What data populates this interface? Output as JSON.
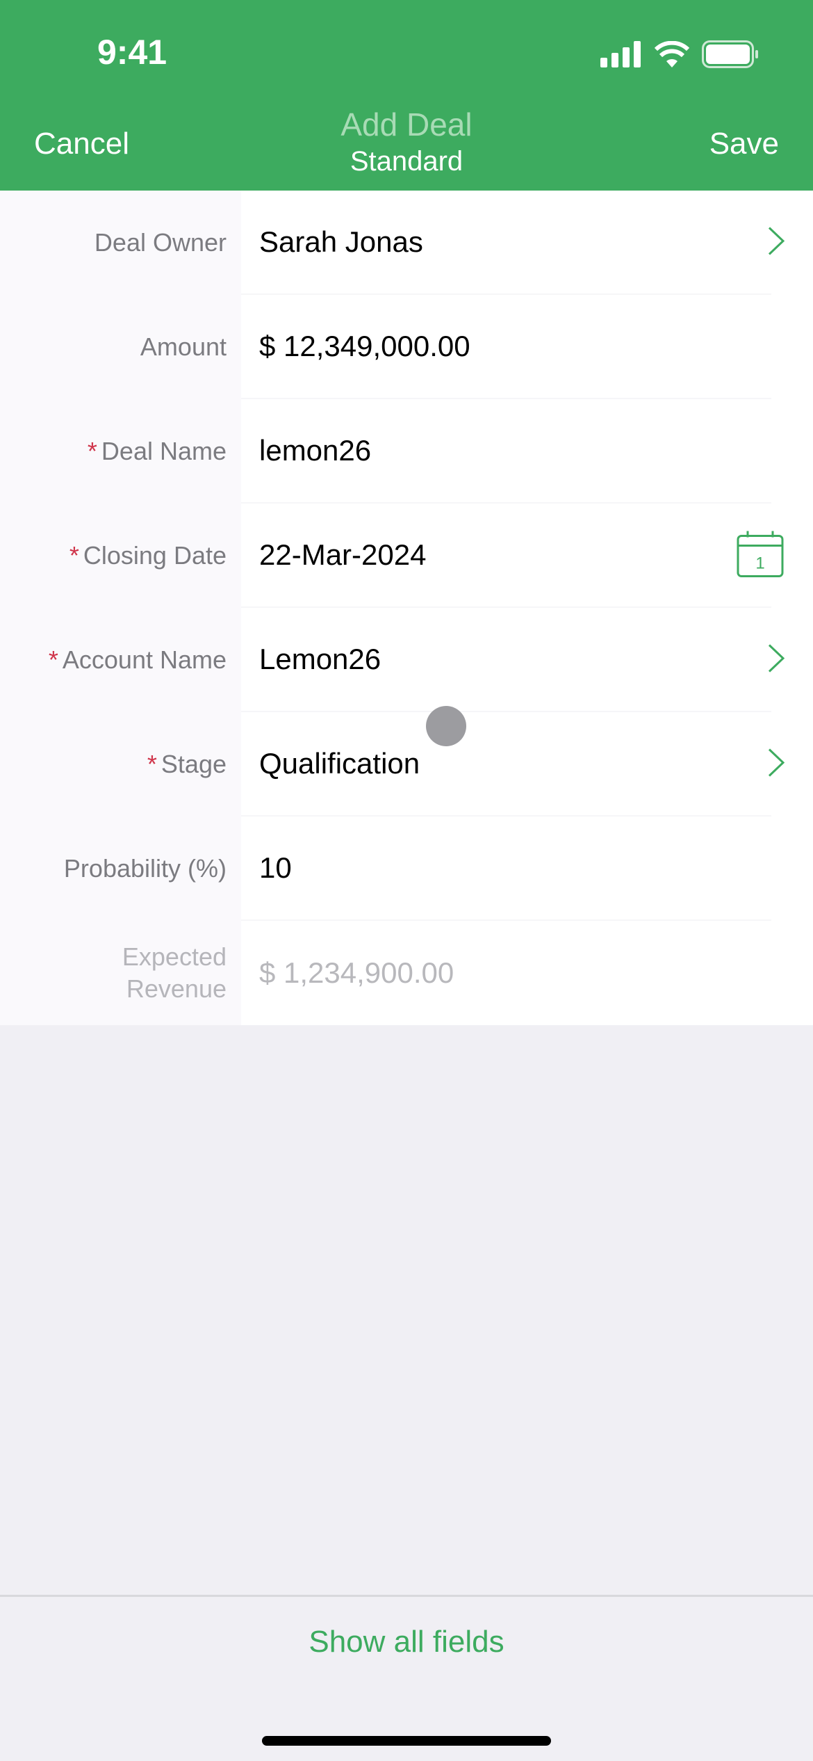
{
  "status_bar": {
    "time": "9:41",
    "icons": [
      "signal-icon",
      "wifi-icon",
      "battery-icon"
    ]
  },
  "nav": {
    "cancel": "Cancel",
    "title": "Add Deal",
    "subtitle": "Standard",
    "save": "Save"
  },
  "colors": {
    "brand": "#3dab5f",
    "required": "#d0354b"
  },
  "fields": [
    {
      "label": "Deal Owner",
      "value": "Sarah Jonas",
      "required": false,
      "trail": "chevron-right-icon"
    },
    {
      "label": "Amount",
      "value": "$ 12,349,000.00",
      "required": false
    },
    {
      "label": "Deal Name",
      "value": "lemon26",
      "required": true
    },
    {
      "label": "Closing Date",
      "value": "22-Mar-2024",
      "required": true,
      "trail": "calendar-icon",
      "calendar_day": "1"
    },
    {
      "label": "Account Name",
      "value": "Lemon26",
      "required": true,
      "trail": "chevron-right-icon"
    },
    {
      "label": "Stage",
      "value": "Qualification",
      "required": true,
      "trail": "chevron-right-icon"
    },
    {
      "label": "Probability (%)",
      "value": "10",
      "required": false
    },
    {
      "label": "Expected Revenue",
      "value": "$ 1,234,900.00",
      "required": false,
      "disabled": true
    }
  ],
  "footer": {
    "show_all": "Show all fields"
  },
  "required_mark": "*"
}
